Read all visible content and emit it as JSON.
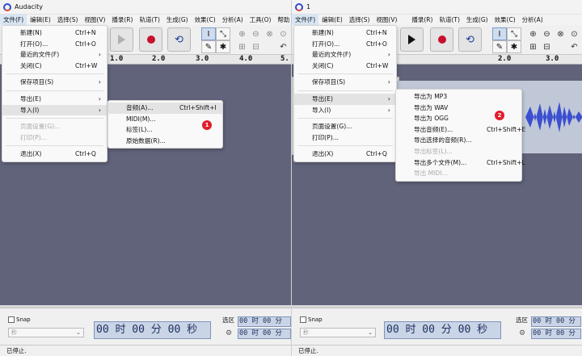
{
  "left": {
    "title": "Audacity",
    "menubar": [
      "文件(F)",
      "编辑(E)",
      "选择(S)",
      "视图(V)",
      "播录(R)",
      "轨道(T)",
      "生成(G)",
      "效果(C)",
      "分析(A)",
      "工具(O)",
      "帮助"
    ],
    "ruler_ticks": [
      "1.0",
      "2.0",
      "3.0",
      "4.0",
      "5."
    ],
    "file_menu": [
      {
        "label": "新建(N)",
        "shortcut": "Ctrl+N"
      },
      {
        "label": "打开(O)...",
        "shortcut": "Ctrl+O"
      },
      {
        "label": "最近的文件(F)",
        "shortcut": "",
        "submenu": true
      },
      {
        "label": "关闭(C)",
        "shortcut": "Ctrl+W"
      },
      {
        "label": "保存项目(S)",
        "shortcut": "",
        "submenu": true
      },
      {
        "label": "导出(E)",
        "shortcut": "",
        "submenu": true
      },
      {
        "label": "导入(I)",
        "shortcut": "",
        "submenu": true
      },
      {
        "label": "页面设置(G)...",
        "shortcut": "",
        "disabled": true
      },
      {
        "label": "打印(P)...",
        "shortcut": "",
        "disabled": true
      },
      {
        "label": "退出(X)",
        "shortcut": "Ctrl+Q"
      }
    ],
    "import_submenu": [
      {
        "label": "音频(A)...",
        "shortcut": "Ctrl+Shift+I"
      },
      {
        "label": "MIDI(M)...",
        "shortcut": ""
      },
      {
        "label": "标签(L)...",
        "shortcut": ""
      },
      {
        "label": "原始数据(R)...",
        "shortcut": ""
      }
    ],
    "badge": "1",
    "snap_label": "Snap",
    "unit_select": "秒",
    "big_time": "00 时 00 分 00 秒",
    "selection_label": "选区",
    "sel_start": "00 时 00 分",
    "sel_end": "00 时 00 分",
    "status": "已停止."
  },
  "right": {
    "title": "1",
    "menubar": [
      "文件(F)",
      "编辑(E)",
      "选择(S)",
      "视图(V)",
      "播录(R)",
      "轨道(T)",
      "生成(G)",
      "效果(C)",
      "分析(A)"
    ],
    "ruler_ticks": [
      "2.0",
      "3.0"
    ],
    "file_menu": [
      {
        "label": "新建(N)",
        "shortcut": "Ctrl+N"
      },
      {
        "label": "打开(O)...",
        "shortcut": "Ctrl+O"
      },
      {
        "label": "最近的文件(F)",
        "shortcut": "",
        "submenu": true
      },
      {
        "label": "关闭(C)",
        "shortcut": "Ctrl+W"
      },
      {
        "label": "保存项目(S)",
        "shortcut": "",
        "submenu": true
      },
      {
        "label": "导出(E)",
        "shortcut": "",
        "submenu": true
      },
      {
        "label": "导入(I)",
        "shortcut": "",
        "submenu": true
      },
      {
        "label": "页面设置(G)...",
        "shortcut": ""
      },
      {
        "label": "打印(P)...",
        "shortcut": ""
      },
      {
        "label": "退出(X)",
        "shortcut": "Ctrl+Q"
      }
    ],
    "export_submenu": [
      {
        "label": "导出为 MP3",
        "shortcut": ""
      },
      {
        "label": "导出为 WAV",
        "shortcut": ""
      },
      {
        "label": "导出为 OGG",
        "shortcut": ""
      },
      {
        "label": "导出音频(E)...",
        "shortcut": "Ctrl+Shift+E"
      },
      {
        "label": "导出选择的音频(R)...",
        "shortcut": ""
      },
      {
        "label": "导出标签(L)...",
        "shortcut": "",
        "disabled": true
      },
      {
        "label": "导出多个文件(M)...",
        "shortcut": "Ctrl+Shift+L"
      },
      {
        "label": "导出 MIDI...",
        "shortcut": "",
        "disabled": true
      }
    ],
    "badge": "2",
    "snap_label": "Snap",
    "unit_select": "秒",
    "big_time": "00 时 00 分 00 秒",
    "selection_label": "选区",
    "sel_start": "00 时 00 分",
    "sel_end": "00 时 00 分",
    "status": "已停止."
  },
  "colors": {
    "track_bg": "#60637a",
    "waveform": "#3b4fd0",
    "record": "#c8102e",
    "badge": "#e11d2b",
    "time_bg": "#c9d4e6"
  }
}
